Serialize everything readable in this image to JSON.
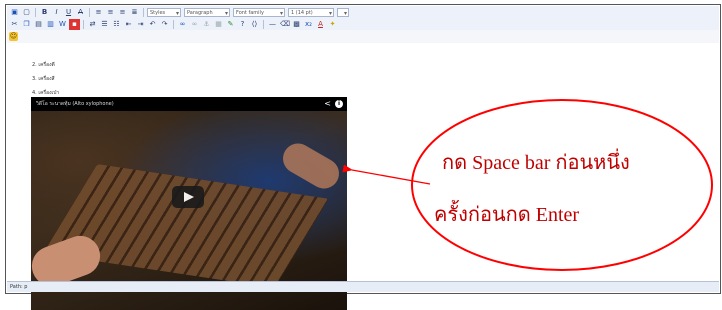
{
  "toolbar": {
    "row1_buttons": [
      "save-icon",
      "new-document-icon",
      "bold-icon",
      "italic-icon",
      "underline-icon",
      "strikethrough-icon",
      "align-left-icon",
      "align-center-icon",
      "align-right-icon",
      "justify-icon"
    ],
    "style_dropdown": "Styles",
    "format_dropdown": "Paragraph",
    "font_dropdown": "Font family",
    "size_dropdown": "1 (14 pt)",
    "extra_dropdown": "",
    "row2_buttons": [
      "cut-icon",
      "copy-icon",
      "paste-icon",
      "paste-text-icon",
      "paste-word-icon",
      "find-icon",
      "replace-icon",
      "bullet-list-icon",
      "number-list-icon",
      "outdent-icon",
      "indent-icon",
      "undo-icon",
      "redo-icon",
      "link-icon",
      "unlink-icon",
      "anchor-icon",
      "image-icon",
      "cleanup-icon",
      "help-icon",
      "code-icon",
      "horizontal-rule-icon",
      "remove-format-icon",
      "visual-aid-icon",
      "sub-icon",
      "font-color-icon",
      "highlight-icon"
    ],
    "emotion_icon": "smiley-icon"
  },
  "content": {
    "list_items": [
      "2. เครื่องตี",
      "3. เครื่องสี",
      "4. เครื่องเป่า"
    ],
    "video": {
      "title": "วิดีโอ ระนาดทุ้ม (Alto xylophone)",
      "share_icon": "share-icon",
      "info_icon": "info-icon",
      "play_icon": "play-icon"
    }
  },
  "status": {
    "path": "Path: p"
  },
  "callout": {
    "line1": "กด Space bar ก่อนหนึ่ง",
    "line2": "ครั้งก่อนกด Enter",
    "color": "#ff0000"
  }
}
